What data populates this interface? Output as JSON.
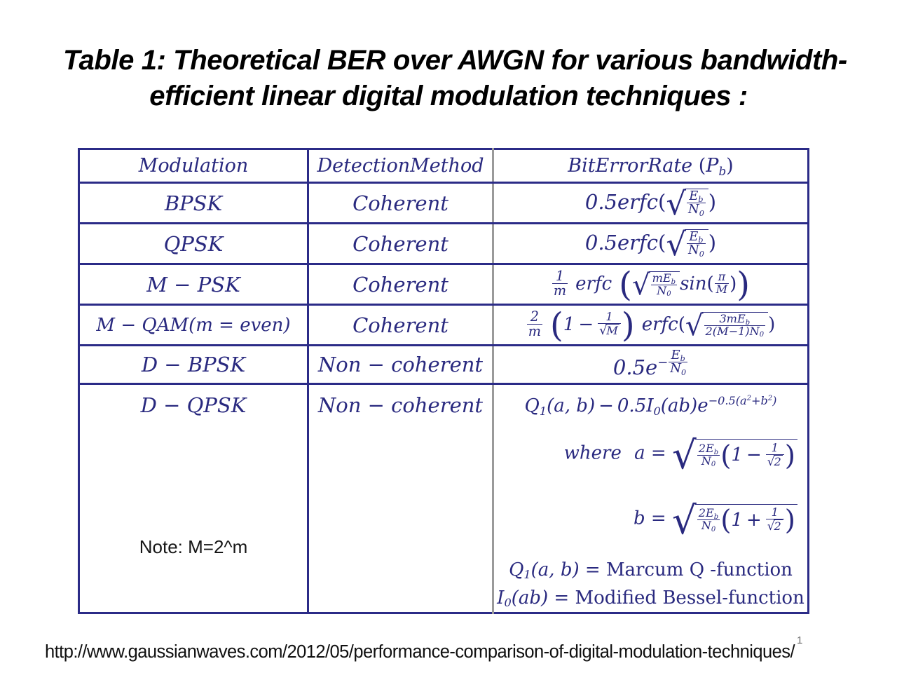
{
  "title": {
    "line_1": "Table 1: Theoretical BER over AWGN for various bandwidth-",
    "line_2": "efficient linear digital modulation techniques :"
  },
  "colors": {
    "math_blue": "#29297f",
    "border_navy": "#2b2b87",
    "border_gray": "#9a9a9a",
    "text_black": "#000000"
  },
  "table": {
    "headers": {
      "modulation": "Modulation",
      "detection_method": "DetectionMethod",
      "bit_error_rate": "BitErrorRate (P_b)"
    },
    "rows": [
      {
        "modulation": "BPSK",
        "detection": "Coherent",
        "ber_text": "0.5 erfc( sqrt( Eb / N0 ) )"
      },
      {
        "modulation": "QPSK",
        "detection": "Coherent",
        "ber_text": "0.5 erfc( sqrt( Eb / N0 ) )"
      },
      {
        "modulation": "M - PSK",
        "detection": "Coherent",
        "ber_text": "(1/m) erfc( sqrt( mEb / N0 ) sin( pi / M ) )"
      },
      {
        "modulation": "M - QAM(m = even)",
        "detection": "Coherent",
        "ber_text": "(2/m) ( 1 - 1/sqrt(M) ) erfc( sqrt( 3mEb / ( 2(M-1)N0 ) ) )"
      },
      {
        "modulation": "D - BPSK",
        "detection": "Non - coherent",
        "ber_text": "0.5 e^( -Eb/N0 )"
      },
      {
        "modulation": "D - QPSK",
        "detection": "Non - coherent",
        "ber_text": "Q1(a, b) - 0.5 I0(ab) e^( -0.5(a^2 + b^2) ); where a = sqrt( 2Eb/N0 ( 1 - 1/sqrt(2) ) ); b = sqrt( 2Eb/N0 ( 1 + 1/sqrt(2) ) ); Q1(a, b) = Marcum Q -function; I0(ab) = Modified Bessel-function"
      }
    ],
    "note": "Note: M=2^m"
  },
  "footer": {
    "source_url": "http://www.gaussianwaves.com/2012/05/performance-comparison-of-digital-modulation-techniques/",
    "page_number": "1"
  },
  "symbols": {
    "minus": "−",
    "pi": "π",
    "radical": "√",
    "paren_open": "(",
    "paren_close": ")"
  }
}
